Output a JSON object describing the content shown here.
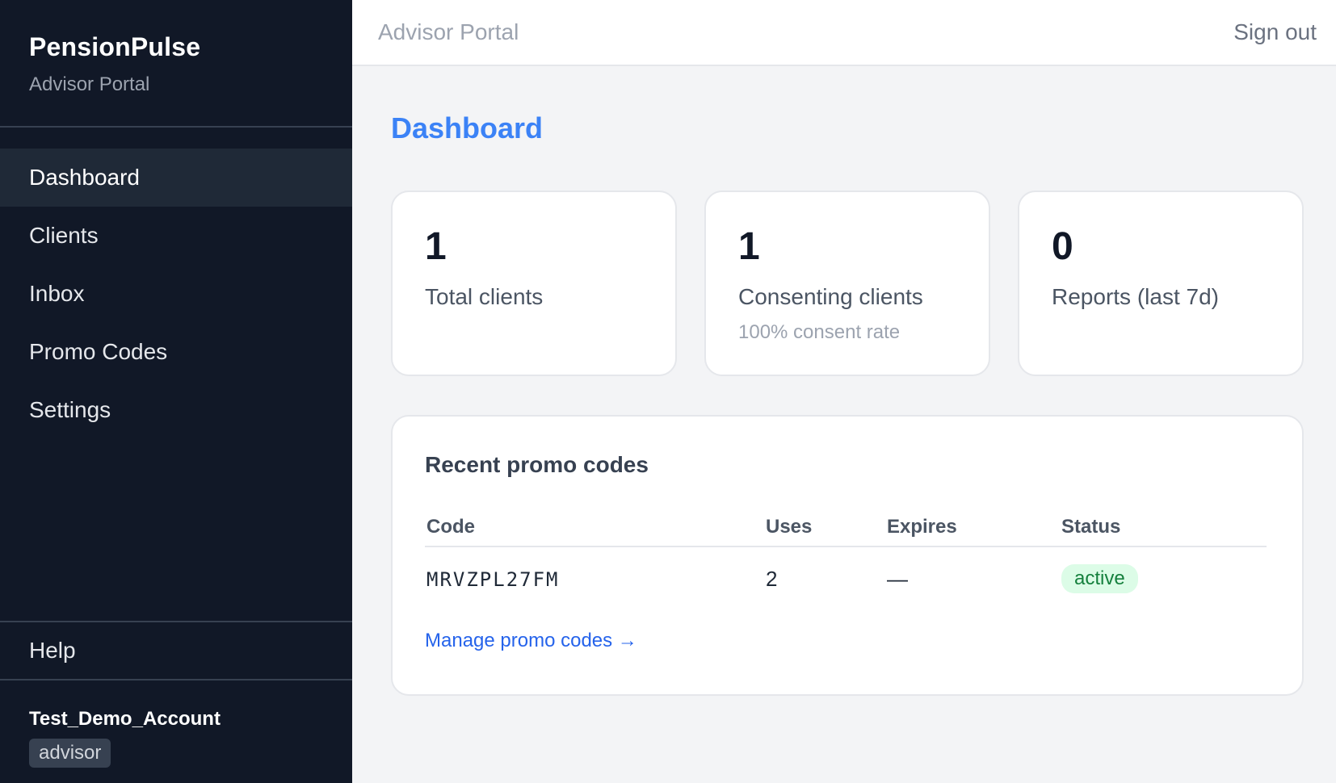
{
  "sidebar": {
    "brand": "PensionPulse",
    "subtitle": "Advisor Portal",
    "items": [
      {
        "label": "Dashboard",
        "active": true
      },
      {
        "label": "Clients"
      },
      {
        "label": "Inbox"
      },
      {
        "label": "Promo Codes"
      },
      {
        "label": "Settings"
      }
    ],
    "help_label": "Help",
    "account": {
      "name": "Test_Demo_Account",
      "role": "advisor"
    }
  },
  "header": {
    "title": "Advisor Portal",
    "signout_label": "Sign out"
  },
  "main": {
    "title": "Dashboard",
    "stats": [
      {
        "value": "1",
        "label": "Total clients"
      },
      {
        "value": "1",
        "label": "Consenting clients",
        "sub": "100% consent rate"
      },
      {
        "value": "0",
        "label": "Reports (last 7d)"
      }
    ],
    "promo": {
      "title": "Recent promo codes",
      "columns": [
        "Code",
        "Uses",
        "Expires",
        "Status"
      ],
      "rows": [
        {
          "code": "MRVZPL27FM",
          "uses": "2",
          "expires": "—",
          "status": "active"
        }
      ],
      "manage_link": "Manage promo codes →"
    }
  },
  "colors": {
    "sidebar_bg": "#111827",
    "accent": "#3b82f6",
    "status_active_bg": "#dcfce7",
    "status_active_text": "#15803d"
  }
}
